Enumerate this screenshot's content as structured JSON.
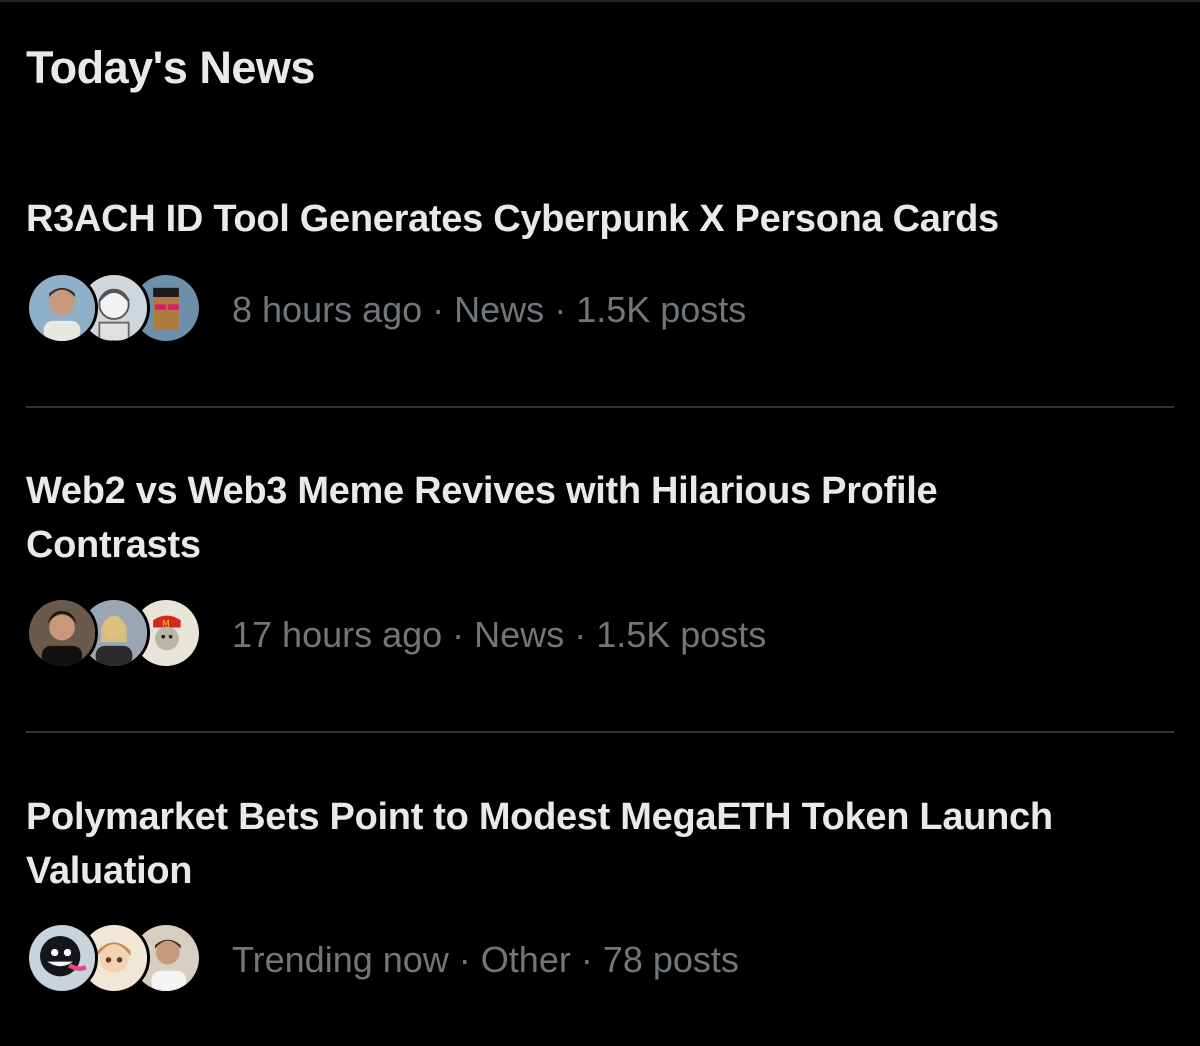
{
  "section": {
    "title": "Today's News"
  },
  "items": [
    {
      "headline": "R3ACH ID Tool Generates Cyberpunk X Persona Cards",
      "time": "8 hours ago",
      "category": "News",
      "posts": "1.5K posts"
    },
    {
      "headline": "Web2 vs Web3 Meme Revives with Hilarious Profile Contrasts",
      "time": "17 hours ago",
      "category": "News",
      "posts": "1.5K posts"
    },
    {
      "headline": "Polymarket Bets Point to Modest MegaETH Token Launch Valuation",
      "time": "Trending now",
      "category": "Other",
      "posts": "78 posts"
    }
  ],
  "separator": " · ",
  "colors": {
    "background": "#000000",
    "headline": "#e7e9ea",
    "meta": "#71767b",
    "divider": "#2f3336"
  }
}
